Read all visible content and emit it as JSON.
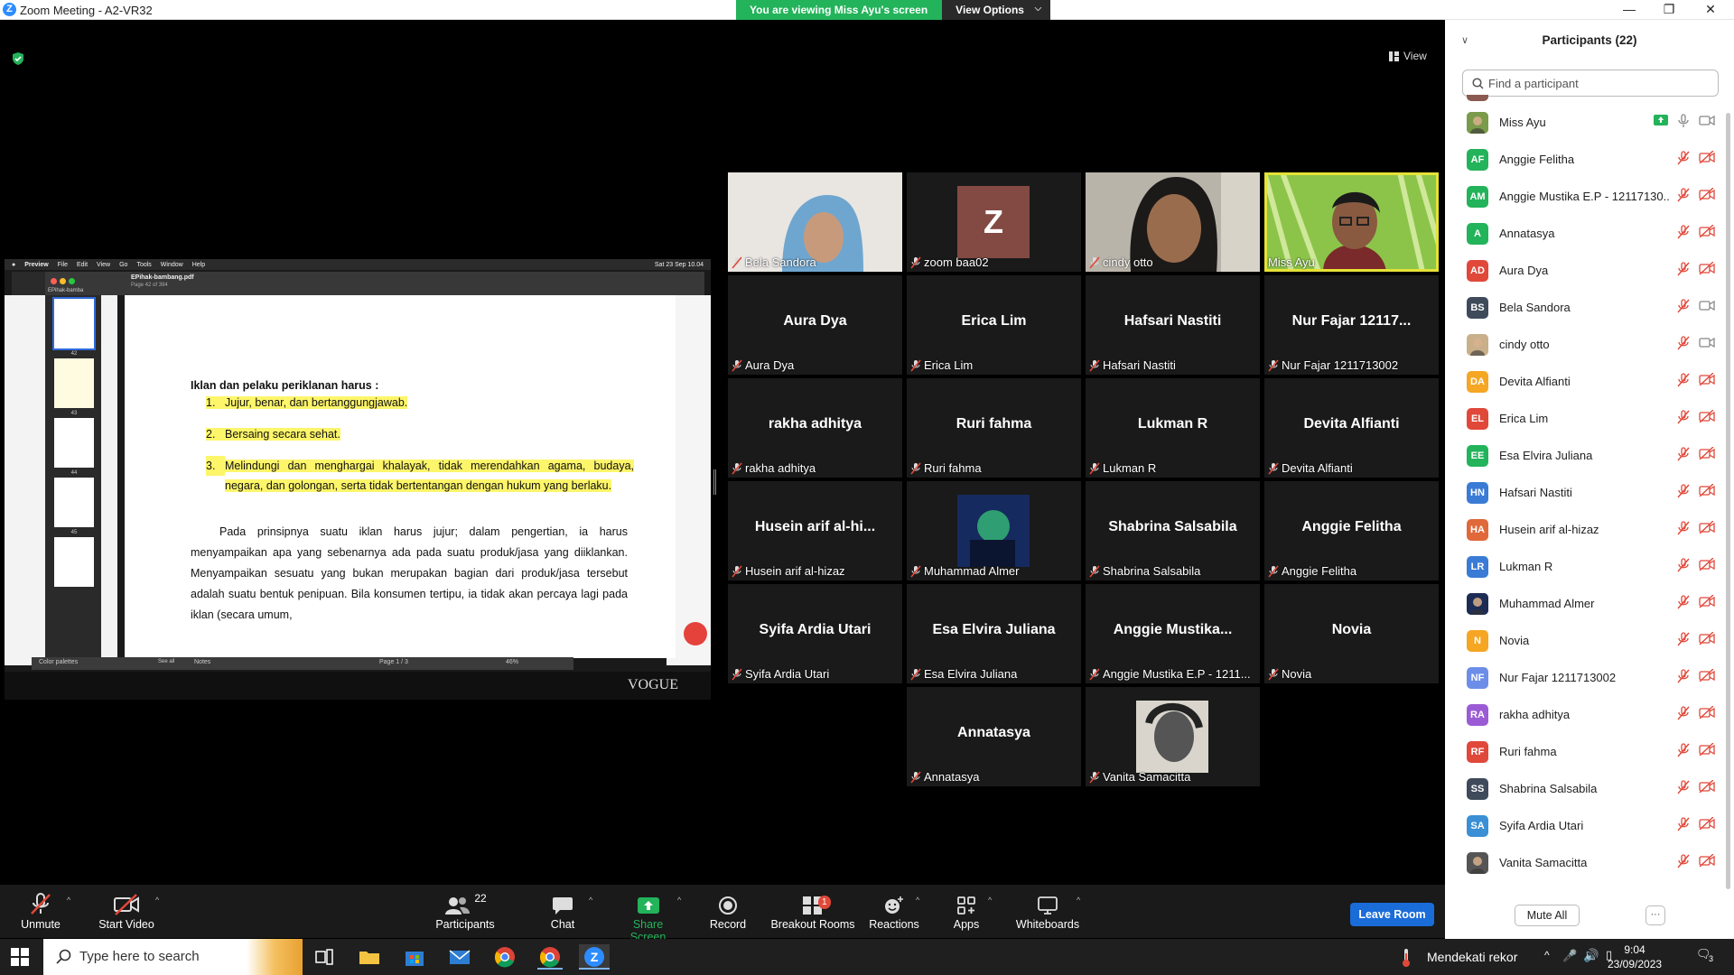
{
  "window": {
    "title": "Zoom Meeting - A2-VR32",
    "logo_letter": "Z"
  },
  "share_banner": {
    "viewing": "You are viewing Miss Ayu's screen",
    "view_options": "View Options"
  },
  "view_button": "View",
  "shared_screen": {
    "mac_menu": [
      "Preview",
      "File",
      "Edit",
      "View",
      "Go",
      "Tools",
      "Window",
      "Help"
    ],
    "mac_clock": "Sat 23 Sep 10.04",
    "file_name": "EPihak-bambang.pdf",
    "page_info": "Page 42 of 394",
    "sidebar_label": "EPihak-bamba",
    "thumbnails": [
      "42",
      "43",
      "44",
      "45"
    ],
    "heading": "Iklan dan pelaku periklanan harus :",
    "list": [
      {
        "n": "1.",
        "text": "Jujur, benar, dan bertanggungjawab."
      },
      {
        "n": "2.",
        "text": "Bersaing secara sehat."
      },
      {
        "n": "3.",
        "text": "Melindungi dan menghargai khalayak, tidak merendahkan agama, budaya, negara, dan golongan, serta  tidak bertentangan dengan hukum yang berlaku."
      }
    ],
    "paragraph": "Pada prinsipnya suatu iklan harus jujur; dalam pengertian, ia harus menyampaikan apa yang sebenarnya ada pada suatu produk/jasa yang diiklankan. Menyampaikan sesuatu yang bukan merupakan bagian dari produk/jasa tersebut adalah suatu bentuk penipuan. Bila konsumen tertipu, ia tidak akan percaya lagi pada iklan (secara umum,",
    "bottom_left": "Color palettes",
    "bottom_seeall": "See all",
    "bottom_notes": "Notes",
    "bottom_page": "Page 1 / 3",
    "bottom_zoom": "46%",
    "brand_text": "VOGUE"
  },
  "tiles": [
    {
      "name": "Bela Sandora",
      "big": "",
      "video": "hijab-person"
    },
    {
      "name": "zoom baa02",
      "big": "",
      "letter": "Z"
    },
    {
      "name": "cindy otto",
      "big": "",
      "video": "person"
    },
    {
      "name": "Miss Ayu",
      "big": "",
      "video": "glasses-person",
      "active": true
    },
    {
      "name": "Aura Dya",
      "big": "Aura Dya"
    },
    {
      "name": "Erica Lim",
      "big": "Erica Lim"
    },
    {
      "name": "Hafsari Nastiti",
      "big": "Hafsari Nastiti"
    },
    {
      "name": "Nur Fajar 1211713002",
      "big": "Nur Fajar 12117..."
    },
    {
      "name": "rakha adhitya",
      "big": "rakha adhitya"
    },
    {
      "name": "Ruri fahma",
      "big": "Ruri fahma"
    },
    {
      "name": "Lukman R",
      "big": "Lukman R"
    },
    {
      "name": "Devita Alfianti",
      "big": "Devita Alfianti"
    },
    {
      "name": "Husein arif al-hizaz",
      "big": "Husein  arif  al-hi..."
    },
    {
      "name": "Muhammad Almer",
      "big": "",
      "video": "avatar-image"
    },
    {
      "name": "Shabrina Salsabila",
      "big": "Shabrina Salsabila"
    },
    {
      "name": "Anggie Felitha",
      "big": "Anggie Felitha"
    },
    {
      "name": "Syifa Ardia Utari",
      "big": "Syifa Ardia Utari"
    },
    {
      "name": "Esa Elvira Juliana",
      "big": "Esa Elvira Juliana"
    },
    {
      "name": "Anggie Mustika E.P - 1211...",
      "big": "Anggie  Mustika..."
    },
    {
      "name": "Novia",
      "big": "Novia"
    },
    {
      "name": "Annatasya",
      "big": "Annatasya"
    },
    {
      "name": "Vanita Samacitta",
      "big": "",
      "video": "avatar-image"
    }
  ],
  "toolbar": {
    "unmute": "Unmute",
    "start_video": "Start Video",
    "participants": "Participants",
    "participants_count": "22",
    "chat": "Chat",
    "share_screen": "Share Screen",
    "record": "Record",
    "breakout": "Breakout Rooms",
    "breakout_badge": "1",
    "reactions": "Reactions",
    "apps": "Apps",
    "whiteboards": "Whiteboards",
    "leave": "Leave Room"
  },
  "panel": {
    "title": "Participants (22)",
    "search_placeholder": "Find a participant",
    "mute_all": "Mute All",
    "more": "···",
    "participants": [
      {
        "name": "Miss Ayu",
        "initials": "",
        "color": "#7a9b4a",
        "photo": true,
        "self": true
      },
      {
        "name": "Anggie Felitha",
        "initials": "AF",
        "color": "#23b35a"
      },
      {
        "name": "Anggie Mustika E.P - 12117130...",
        "initials": "AM",
        "color": "#23b35a"
      },
      {
        "name": "Annatasya",
        "initials": "A",
        "color": "#23b35a"
      },
      {
        "name": "Aura Dya",
        "initials": "AD",
        "color": "#e0483a"
      },
      {
        "name": "Bela Sandora",
        "initials": "BS",
        "color": "#3f4a5a",
        "cam_on": true
      },
      {
        "name": "cindy otto",
        "initials": "",
        "color": "#c9b08a",
        "photo": true,
        "cam_on": true
      },
      {
        "name": "Devita Alfianti",
        "initials": "DA",
        "color": "#f5a623"
      },
      {
        "name": "Erica Lim",
        "initials": "EL",
        "color": "#e0483a"
      },
      {
        "name": "Esa Elvira Juliana",
        "initials": "EE",
        "color": "#23b35a"
      },
      {
        "name": "Hafsari Nastiti",
        "initials": "HN",
        "color": "#3a7bd5"
      },
      {
        "name": "Husein arif al-hizaz",
        "initials": "HA",
        "color": "#e0683a"
      },
      {
        "name": "Lukman R",
        "initials": "LR",
        "color": "#3a7bd5"
      },
      {
        "name": "Muhammad Almer",
        "initials": "",
        "color": "#1d2c55",
        "photo": true
      },
      {
        "name": "Novia",
        "initials": "N",
        "color": "#f5a623"
      },
      {
        "name": "Nur Fajar 1211713002",
        "initials": "NF",
        "color": "#6c8ee8"
      },
      {
        "name": "rakha adhitya",
        "initials": "RA",
        "color": "#9b5bd5"
      },
      {
        "name": "Ruri fahma",
        "initials": "RF",
        "color": "#e0483a"
      },
      {
        "name": "Shabrina Salsabila",
        "initials": "SS",
        "color": "#3f4a5a"
      },
      {
        "name": "Syifa Ardia Utari",
        "initials": "SA",
        "color": "#3a8fd5"
      },
      {
        "name": "Vanita Samacitta",
        "initials": "",
        "color": "#555",
        "photo": true
      }
    ]
  },
  "taskbar": {
    "search_placeholder": "Type here to search",
    "tray_text": "Mendekati rekor",
    "time": "9:04",
    "date": "23/09/2023",
    "notif_count": "3"
  },
  "colors": {
    "accent": "#2d8cff",
    "share_green": "#23b35a",
    "active_border": "#e5e236",
    "mute_red": "#e0483a"
  }
}
